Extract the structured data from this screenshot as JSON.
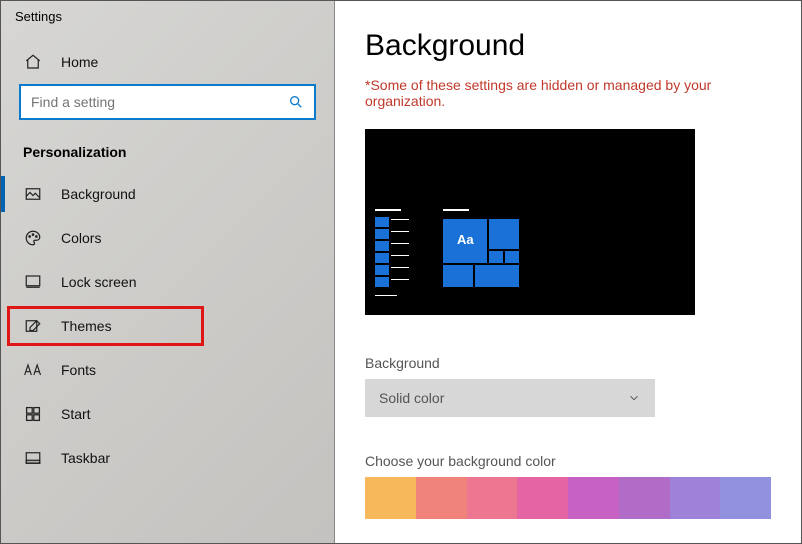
{
  "window": {
    "title": "Settings"
  },
  "sidebar": {
    "home_label": "Home",
    "search_placeholder": "Find a setting",
    "category_label": "Personalization",
    "items": [
      {
        "label": "Background",
        "icon": "image-icon",
        "active": true
      },
      {
        "label": "Colors",
        "icon": "palette-icon"
      },
      {
        "label": "Lock screen",
        "icon": "lockscreen-icon"
      },
      {
        "label": "Themes",
        "icon": "themes-icon",
        "highlight": true
      },
      {
        "label": "Fonts",
        "icon": "fonts-icon"
      },
      {
        "label": "Start",
        "icon": "start-icon"
      },
      {
        "label": "Taskbar",
        "icon": "taskbar-icon"
      }
    ]
  },
  "main": {
    "title": "Background",
    "warning": "*Some of these settings are hidden or managed by your organization.",
    "preview_sample_text": "Aa",
    "bg_label": "Background",
    "bg_value": "Solid color",
    "color_label": "Choose your background color",
    "swatches": [
      "#f7b85b",
      "#f0847a",
      "#ed7691",
      "#e564a3",
      "#c762c4",
      "#b06cc7",
      "#9e82da",
      "#9191e0"
    ]
  }
}
